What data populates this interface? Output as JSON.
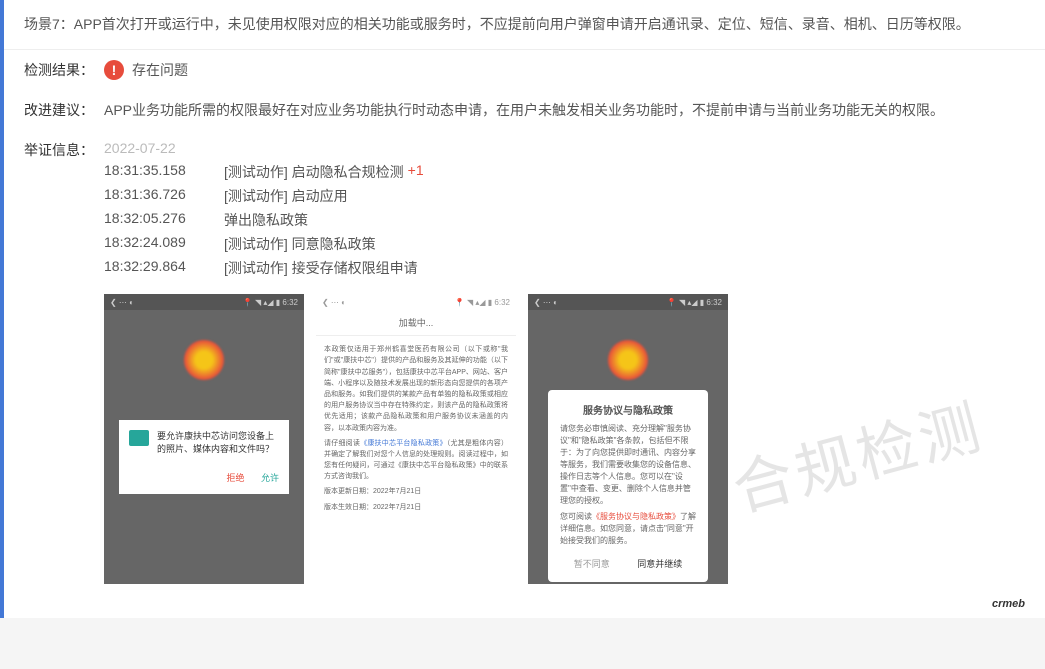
{
  "scenario": {
    "title": "场景7：APP首次打开或运行中，未见使用权限对应的相关功能或服务时，不应提前向用户弹窗申请开启通讯录、定位、短信、录音、相机、日历等权限。"
  },
  "result": {
    "label": "检测结果：",
    "icon": "!",
    "text": "存在问题"
  },
  "suggestion": {
    "label": "改进建议：",
    "text": "APP业务功能所需的权限最好在对应业务功能执行时动态申请，在用户未触发相关业务功能时，不提前申请与当前业务功能无关的权限。"
  },
  "evidence": {
    "label": "举证信息：",
    "date": "2022-07-22",
    "logs": [
      {
        "time": "18:31:35.158",
        "action": "[测试动作] 启动隐私合规检测",
        "plus": "+1"
      },
      {
        "time": "18:31:36.726",
        "action": "[测试动作] 启动应用",
        "plus": ""
      },
      {
        "time": "18:32:05.276",
        "action": "弹出隐私政策",
        "plus": ""
      },
      {
        "time": "18:32:24.089",
        "action": "[测试动作] 同意隐私政策",
        "plus": ""
      },
      {
        "time": "18:32:29.864",
        "action": "[测试动作] 接受存储权限组申请",
        "plus": ""
      }
    ]
  },
  "phones": {
    "statusbar_left": "❮ ⋯ ◐",
    "statusbar_right": "📍 ◥ ▴◢ ▮ 6:32",
    "perm": {
      "text": "要允许康扶中芯访问您设备上的照片、媒体内容和文件吗？",
      "deny": "拒绝",
      "allow": "允许"
    },
    "long": {
      "header": "加载中...",
      "p1": "本政策仅适用于郑州鹤喜堂医药有限公司（以下或称\"我们\"或\"康扶中芯\"）提供的产品和服务及其延伸的功能（以下简称\"康扶中芯服务\"），包括康扶中芯平台APP、网站、客户端、小程序以及随技术发展出现的新形态向您提供的各项产品和服务。如我们提供的某款产品有单独的隐私政策或相应的用户服务协议当中存在特殊约定，则该产品的隐私政策将优先适用；该款产品隐私政策和用户服务协议未涵盖的内容，以本政策内容为准。",
      "p2_1": "请仔细阅读",
      "p2_link": "《康扶中芯平台隐私政策》",
      "p2_2": "（尤其是粗体内容）并确定了解我们对您个人信息的处理规则。阅读过程中，如您有任何疑问，可通过《康扶中芯平台隐私政策》中的联系方式咨询我们。",
      "date1": "版本更新日期：2022年7月21日",
      "date2": "版本生效日期：2022年7月21日"
    },
    "agree": {
      "title": "服务协议与隐私政策",
      "body1": "请您务必审慎阅读、充分理解\"服务协议\"和\"隐私政策\"各条款，包括但不限于：为了向您提供即时通讯、内容分享等服务，我们需要收集您的设备信息、操作日志等个人信息。您可以在\"设置\"中查看、变更、删除个人信息并管理您的授权。",
      "body2_1": "您可阅读",
      "body2_link": "《服务协议与隐私政策》",
      "body2_2": "了解详细信息。如您同意，请点击\"同意\"开始接受我们的服务。",
      "btn_no": "暂不同意",
      "btn_yes": "同意并继续"
    }
  },
  "watermark": "合规检测",
  "footer": "crmeb"
}
